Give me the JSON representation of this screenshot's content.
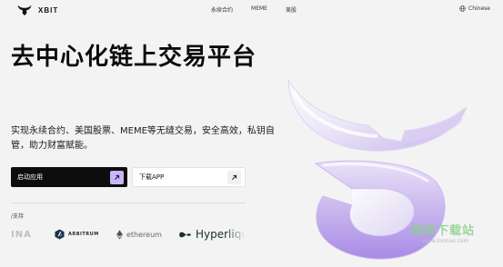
{
  "nav": {
    "brand": "XBIT",
    "links": [
      "永续合约",
      "MEME",
      "美股"
    ],
    "language": "Chinese"
  },
  "hero": {
    "title": "去中心化链上交易平台",
    "description": "实现永续合约、美国股票、MEME等无缝交易，安全高效，私钥自管，助力财富赋能。"
  },
  "buttons": {
    "primary_label": "启动应用",
    "secondary_label": "下载APP"
  },
  "support": {
    "label": "/支持",
    "partners": [
      "INA",
      "ARBITRUM",
      "ethereum",
      "Hyperliqui"
    ]
  },
  "watermark": {
    "text": "绿软下载站",
    "url": "www.lrxmao.com"
  },
  "colors": {
    "background": "#f3f3f4",
    "accent": "#c9b6f7",
    "primary_button": "#0d0d0f"
  },
  "icons": [
    "xbit-bull-logo-icon",
    "globe-icon",
    "arrow-up-right-icon",
    "arbitrum-icon",
    "ethereum-icon",
    "hyperliquid-icon"
  ]
}
